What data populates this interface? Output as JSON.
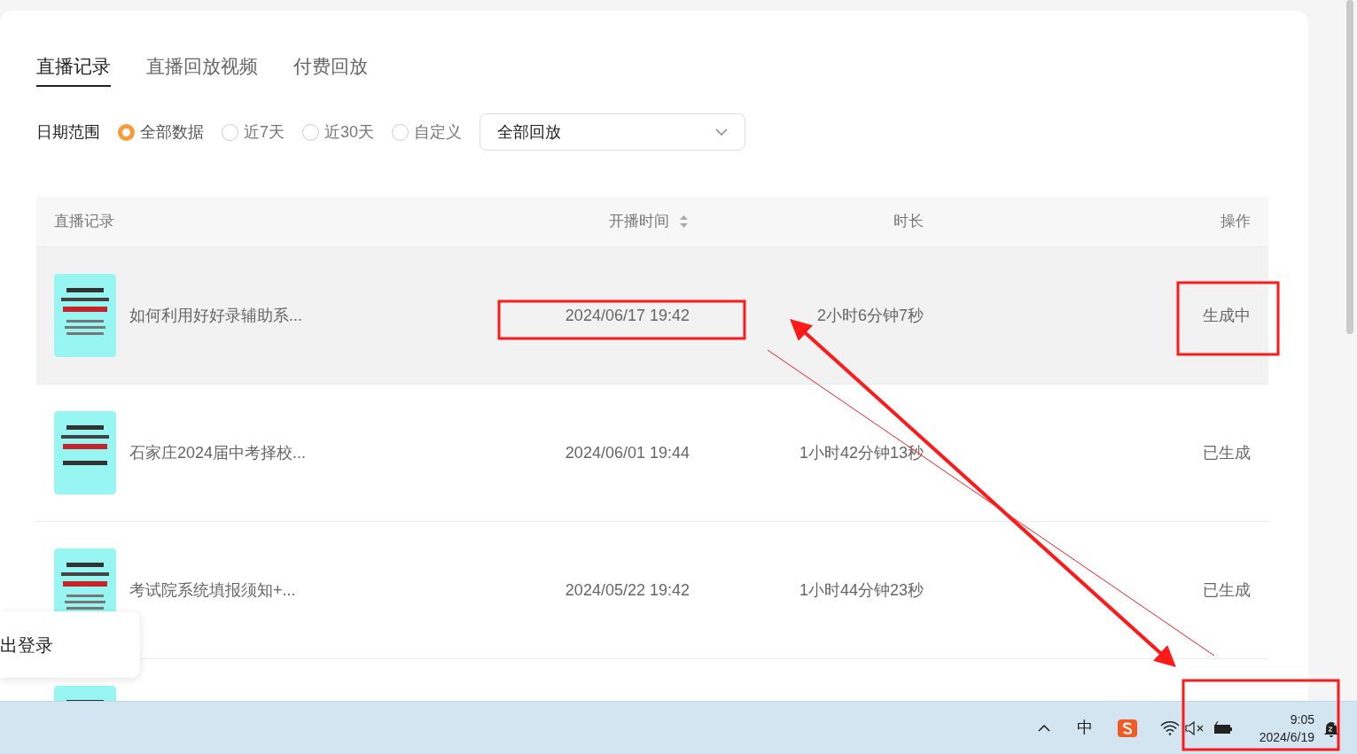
{
  "tabs": [
    {
      "label": "直播记录",
      "selected": true
    },
    {
      "label": "直播回放视频",
      "selected": false
    },
    {
      "label": "付费回放",
      "selected": false
    }
  ],
  "filter": {
    "label": "日期范围",
    "options": [
      {
        "label": "全部数据",
        "selected": true
      },
      {
        "label": "近7天",
        "selected": false
      },
      {
        "label": "近30天",
        "selected": false
      },
      {
        "label": "自定义",
        "selected": false
      }
    ],
    "dropdown": {
      "value": "全部回放"
    }
  },
  "table": {
    "columns": [
      {
        "label": "直播记录",
        "sortable": false
      },
      {
        "label": "开播时间",
        "sortable": true
      },
      {
        "label": "时长",
        "sortable": false
      },
      {
        "label": "操作",
        "sortable": false
      }
    ],
    "rows": [
      {
        "title": "如何利用好好录辅助系...",
        "start": "2024/06/17 19:42",
        "duration": "2小时6分钟7秒",
        "action": "生成中",
        "hovered": true
      },
      {
        "title": "石家庄2024届中考择校...",
        "start": "2024/06/01 19:44",
        "duration": "1小时42分钟13秒",
        "action": "已生成",
        "hovered": false
      },
      {
        "title": "考试院系统填报须知+...",
        "start": "2024/05/22 19:42",
        "duration": "1小时44分钟23秒",
        "action": "已生成",
        "hovered": false
      },
      {
        "hovered": false
      }
    ]
  },
  "popup": {
    "label": "出登录"
  },
  "taskbar": {
    "ime": "中",
    "time": "9:05",
    "date": "2024/6/19"
  }
}
